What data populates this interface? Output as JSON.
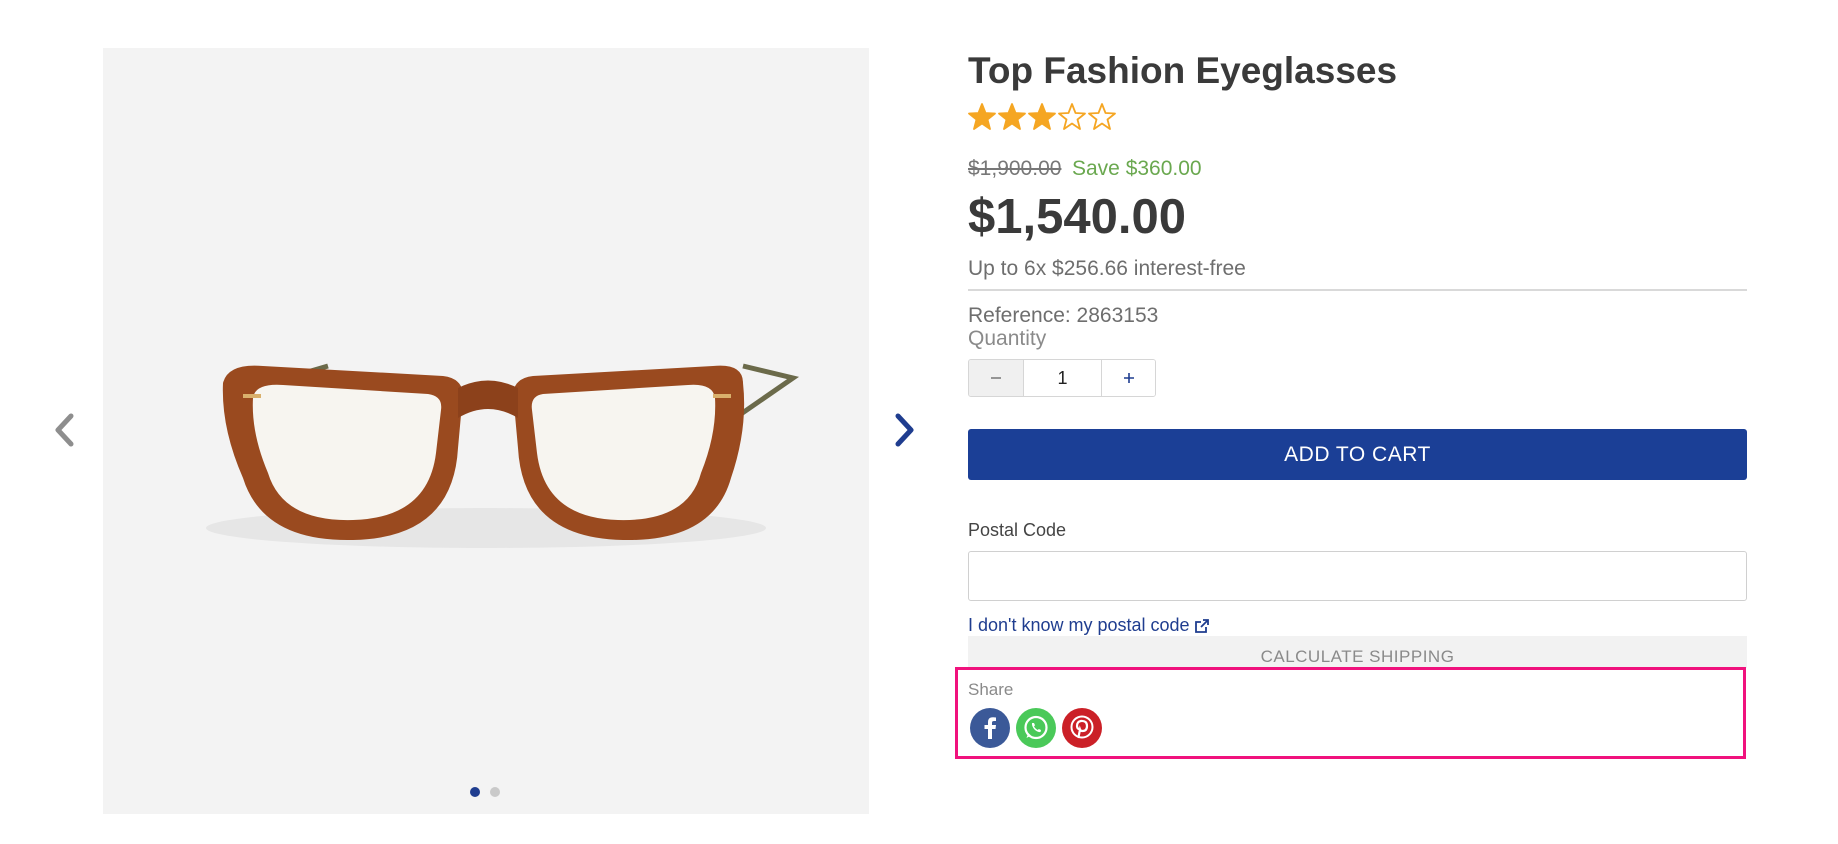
{
  "product": {
    "title": "Top Fashion Eyeglasses",
    "rating": 3,
    "rating_max": 5,
    "old_price": "$1,900.00",
    "save_text": "Save $360.00",
    "price": "$1,540.00",
    "installments": "Up to 6x $256.66 interest-free",
    "reference": "Reference: 2863153",
    "quantity_label": "Quantity",
    "quantity_value": "1",
    "add_to_cart_label": "ADD TO CART"
  },
  "gallery": {
    "slide_count": 2,
    "active_slide": 1,
    "prev_icon": "chevron-left-icon",
    "next_icon": "chevron-right-icon"
  },
  "shipping": {
    "postal_label": "Postal Code",
    "postal_value": "",
    "postal_link": "I don't know my postal code",
    "calculate_label": "CALCULATE SHIPPING"
  },
  "share": {
    "label": "Share",
    "networks": [
      "facebook",
      "whatsapp",
      "pinterest"
    ]
  },
  "colors": {
    "primary": "#1b3f96",
    "save_green": "#6aa84f",
    "star": "#f5a623",
    "highlight": "#f0127d",
    "facebook": "#3b5998",
    "whatsapp": "#4ac959",
    "pinterest": "#cb2027"
  }
}
